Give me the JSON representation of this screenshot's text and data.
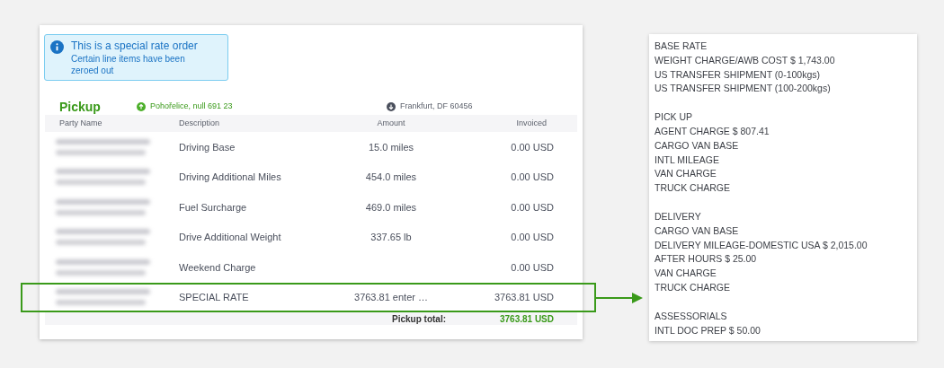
{
  "notice": {
    "title": "This is a special rate order",
    "message": "Certain line items have been zeroed out"
  },
  "pickup": {
    "title": "Pickup",
    "origin": "Pohořelice, null 691 23",
    "destination": "Frankfurt, DF 60456",
    "columns": [
      "Party Name",
      "Description",
      "Amount",
      "Invoiced"
    ],
    "rows": [
      {
        "description": "Driving Base",
        "amount": "15.0 miles",
        "invoiced": "0.00 USD",
        "highlighted": false
      },
      {
        "description": "Driving Additional Miles",
        "amount": "454.0 miles",
        "invoiced": "0.00 USD",
        "highlighted": false
      },
      {
        "description": "Fuel Surcharge",
        "amount": "469.0 miles",
        "invoiced": "0.00 USD",
        "highlighted": false
      },
      {
        "description": "Drive Additional Weight",
        "amount": "337.65 lb",
        "invoiced": "0.00 USD",
        "highlighted": false
      },
      {
        "description": "Weekend Charge",
        "invoiced": "0.00 USD",
        "highlighted": false
      },
      {
        "description": "SPECIAL RATE",
        "amount": "3763.81 enter …",
        "invoiced": "3763.81 USD",
        "highlighted": true
      }
    ],
    "total_label": "Pickup total:",
    "total_value": "3763.81 USD"
  },
  "rate_notes": [
    {
      "heading": "BASE RATE",
      "lines": [
        "WEIGHT CHARGE/AWB COST $ 1,743.00",
        "US TRANSFER SHIPMENT (0-100kgs)",
        "US TRANSFER SHIPMENT (100-200kgs)"
      ]
    },
    {
      "heading": "PICK UP",
      "lines": [
        "AGENT CHARGE $ 807.41",
        "CARGO VAN BASE",
        "INTL MILEAGE",
        "VAN CHARGE",
        "TRUCK CHARGE"
      ]
    },
    {
      "heading": "DELIVERY",
      "lines": [
        "CARGO VAN BASE",
        "DELIVERY MILEAGE-DOMESTIC USA $ 2,015.00",
        "AFTER HOURS $ 25.00",
        "VAN CHARGE",
        "TRUCK CHARGE"
      ]
    },
    {
      "heading": "ASSESSORIALS",
      "lines": [
        "INTL DOC PREP $ 50.00"
      ]
    }
  ]
}
